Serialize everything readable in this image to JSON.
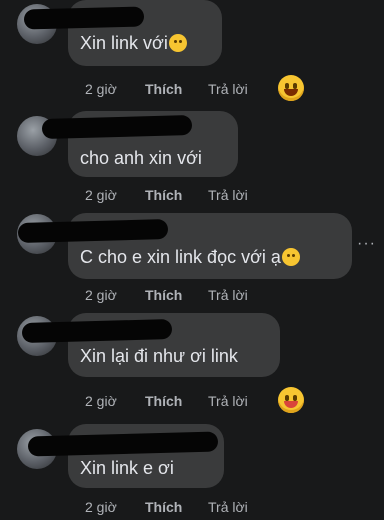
{
  "comments": [
    {
      "text": "Xin link với",
      "emoji": "😶",
      "time": "2 giờ",
      "like": "Thích",
      "reply": "Trả lời",
      "reaction": "😆"
    },
    {
      "text": "cho anh xin với",
      "emoji": "",
      "time": "2 giờ",
      "like": "Thích",
      "reply": "Trả lời",
      "reaction": ""
    },
    {
      "text": "C cho e xin link đọc với ạ",
      "emoji": "🥺",
      "time": "2 giờ",
      "like": "Thích",
      "reply": "Trả lời",
      "reaction": ""
    },
    {
      "text": "Xin lại đi như ơi link",
      "emoji": "",
      "time": "2 giờ",
      "like": "Thích",
      "reply": "Trả lời",
      "reaction": "😝"
    },
    {
      "text": "Xin link e ơi",
      "emoji": "",
      "time": "2 giờ",
      "like": "Thích",
      "reply": "Trả lời",
      "reaction": ""
    }
  ],
  "more_options_label": "···",
  "colors": {
    "background": "#18191a",
    "bubble": "#3a3b3c",
    "text": "#e4e6eb",
    "meta": "#b0b3b8"
  }
}
